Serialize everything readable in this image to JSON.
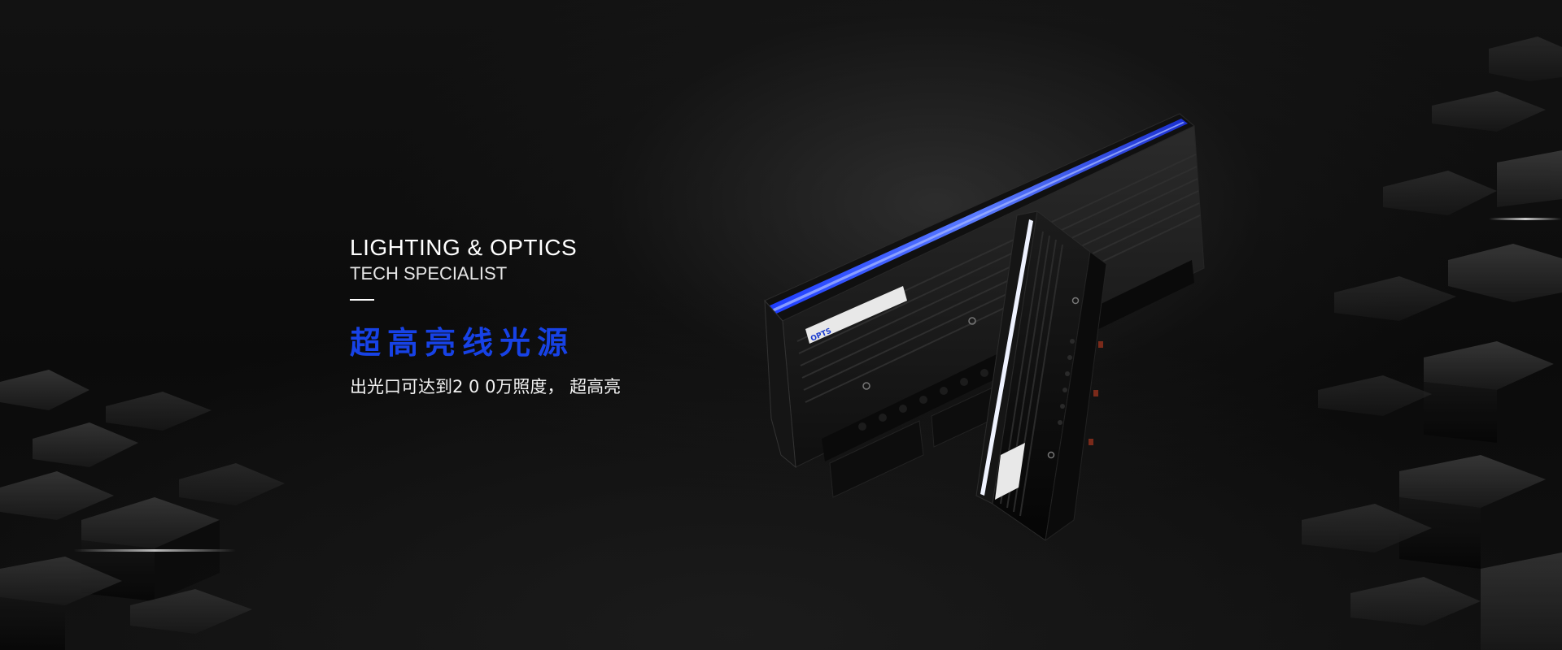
{
  "banner": {
    "headline": "LIGHTING & OPTICS",
    "subheadline": "TECH SPECIALIST",
    "product_title": "超高亮线光源",
    "product_description": "出光口可达到2 0 0万照度， 超高亮",
    "product_logo_text": "OPTS"
  },
  "colors": {
    "accent_blue": "#1742e6",
    "background": "#0a0a0a",
    "text": "#ffffff",
    "light_glow": "#2a4cff"
  }
}
